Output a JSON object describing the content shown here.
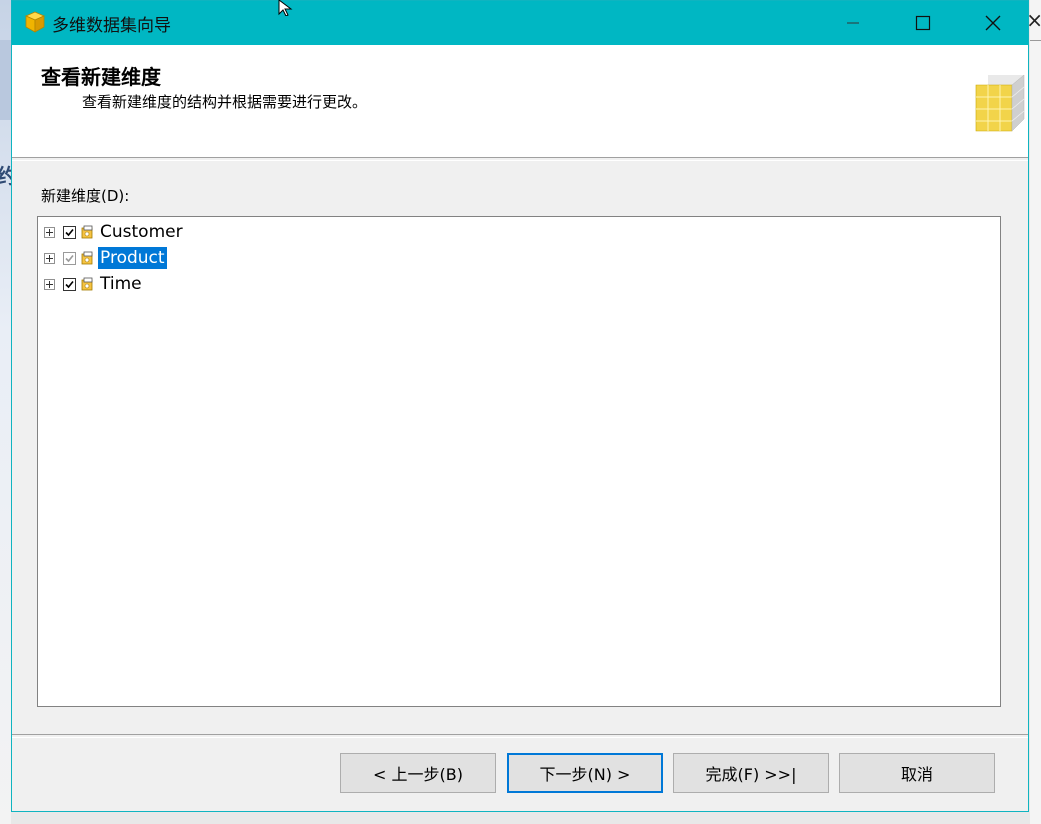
{
  "window": {
    "title": "多维数据集向导"
  },
  "header": {
    "title": "查看新建维度",
    "subtitle": "查看新建维度的结构并根据需要进行更改。"
  },
  "list": {
    "label": "新建维度(D):",
    "items": [
      {
        "label": "Customer",
        "checked": true,
        "enabled": true,
        "selected": false
      },
      {
        "label": "Product",
        "checked": true,
        "enabled": false,
        "selected": true
      },
      {
        "label": "Time",
        "checked": true,
        "enabled": true,
        "selected": false
      }
    ]
  },
  "buttons": {
    "prev": "< 上一步(B)",
    "next": "下一步(N) >",
    "finish": "完成(F) >>|",
    "cancel": "取消"
  },
  "colors": {
    "titlebar": "#00b7c3",
    "selection": "#0078d7",
    "default_button_border": "#0078d7"
  },
  "icons": {
    "app": "cube-icon",
    "header": "cube-grid-icon",
    "dimension": "dimension-icon"
  }
}
